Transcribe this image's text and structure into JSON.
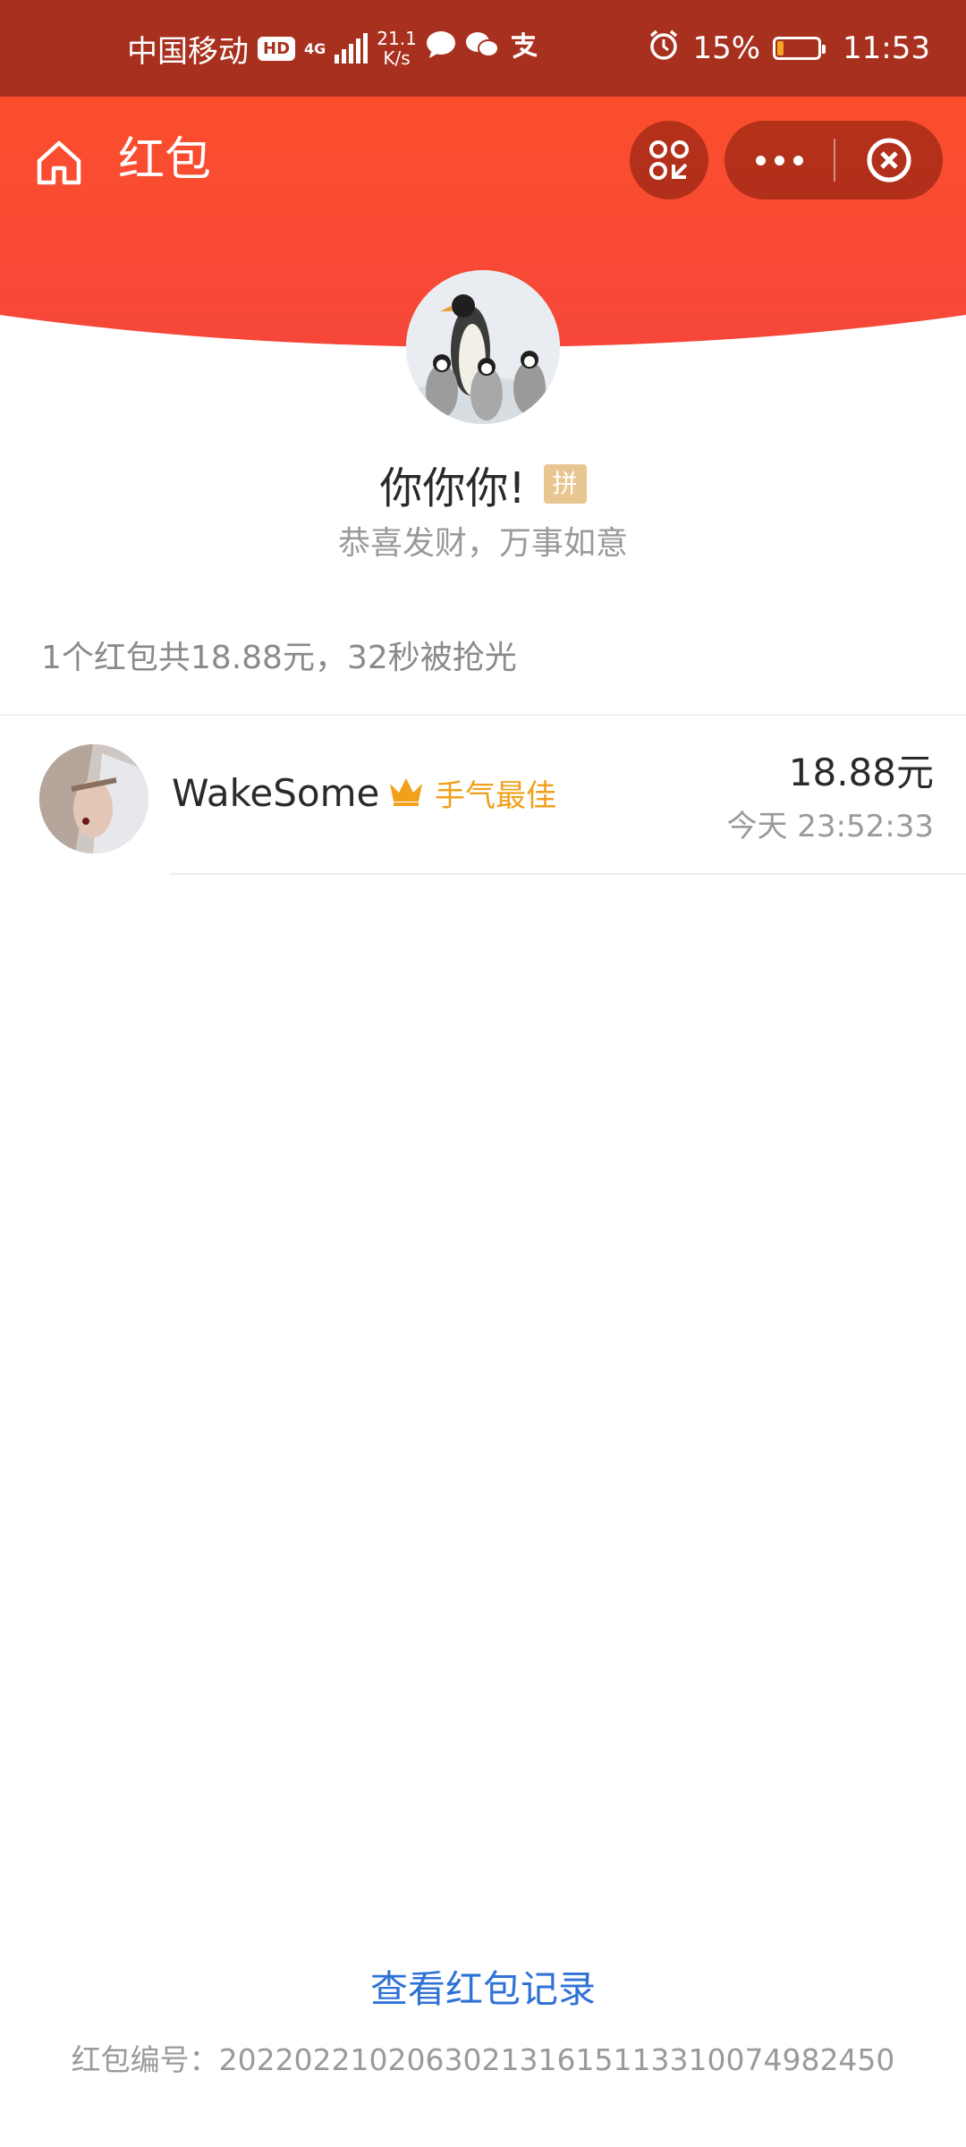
{
  "status_bar": {
    "carrier": "中国移动",
    "hd": "HD",
    "network": "4G",
    "net_speed": "21.1",
    "net_speed_unit": "K/s",
    "battery_percent": "15%",
    "battery_level": 0.15,
    "time": "11:53",
    "icons": [
      "message-icon",
      "wechat-icon",
      "alipay-icon",
      "alarm-icon"
    ]
  },
  "nav": {
    "title": "红包"
  },
  "sender": {
    "name": "你你你!",
    "badge": "拼",
    "greeting": "恭喜发财，万事如意"
  },
  "summary": "1个红包共18.88元，32秒被抢光",
  "receivers": [
    {
      "name": "WakeSome",
      "tag": "手气最佳",
      "amount": "18.88元",
      "time": "今天 23:52:33"
    }
  ],
  "footer": {
    "record_link": "查看红包记录",
    "packet_id": "红包编号：20220221020630213161511331007498245​0"
  },
  "colors": {
    "status_bar": "#a8301e",
    "header_red": "#fb4e2c",
    "lucky_gold": "#f0a01a",
    "link_blue": "#2f72d6"
  }
}
